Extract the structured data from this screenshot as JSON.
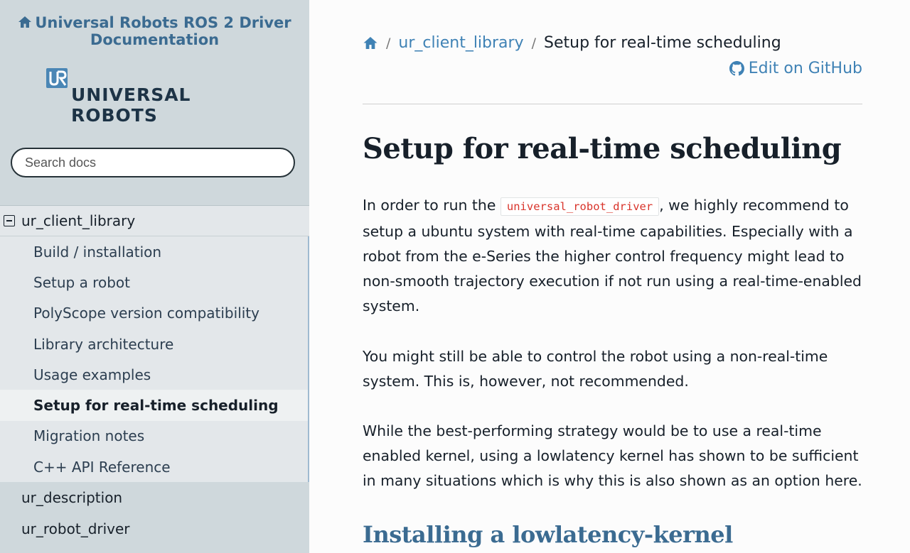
{
  "sidebar": {
    "project_title": "Universal Robots ROS 2 Driver Documentation",
    "logo_text": "UNIVERSAL ROBOTS",
    "search_placeholder": "Search docs",
    "nav_root": "ur_client_library",
    "nav_children": [
      "Build / installation",
      "Setup a robot",
      "PolyScope version compatibility",
      "Library architecture",
      "Usage examples",
      "Setup for real-time scheduling",
      "Migration notes",
      "C++ API Reference"
    ],
    "nav_top": [
      "ur_description",
      "ur_robot_driver"
    ]
  },
  "breadcrumb": {
    "sep": "/",
    "parent": "ur_client_library",
    "current": "Setup for real-time scheduling"
  },
  "edit_link": "Edit on GitHub",
  "main": {
    "title": "Setup for real-time scheduling",
    "p1_before": "In order to run the ",
    "p1_code": "universal_robot_driver",
    "p1_after": ", we highly recommend to setup a ubuntu system with real-time capabilities. Especially with a robot from the e-Series the higher control frequency might lead to non-smooth trajectory execution if not run using a real-time-enabled system.",
    "p2": "You might still be able to control the robot using a non-real-time system. This is, however, not recommended.",
    "p3": "While the best-performing strategy would be to use a real-time enabled kernel, using a lowlatency kernel has shown to be sufficient in many situations which is why this is also shown as an option here.",
    "h2": "Installing a lowlatency-kernel"
  },
  "colors": {
    "link": "#3f82b5",
    "sidebar_bg": "#cfd8dc",
    "heading_blue": "#3b6b91",
    "code_red": "#d9342b"
  }
}
